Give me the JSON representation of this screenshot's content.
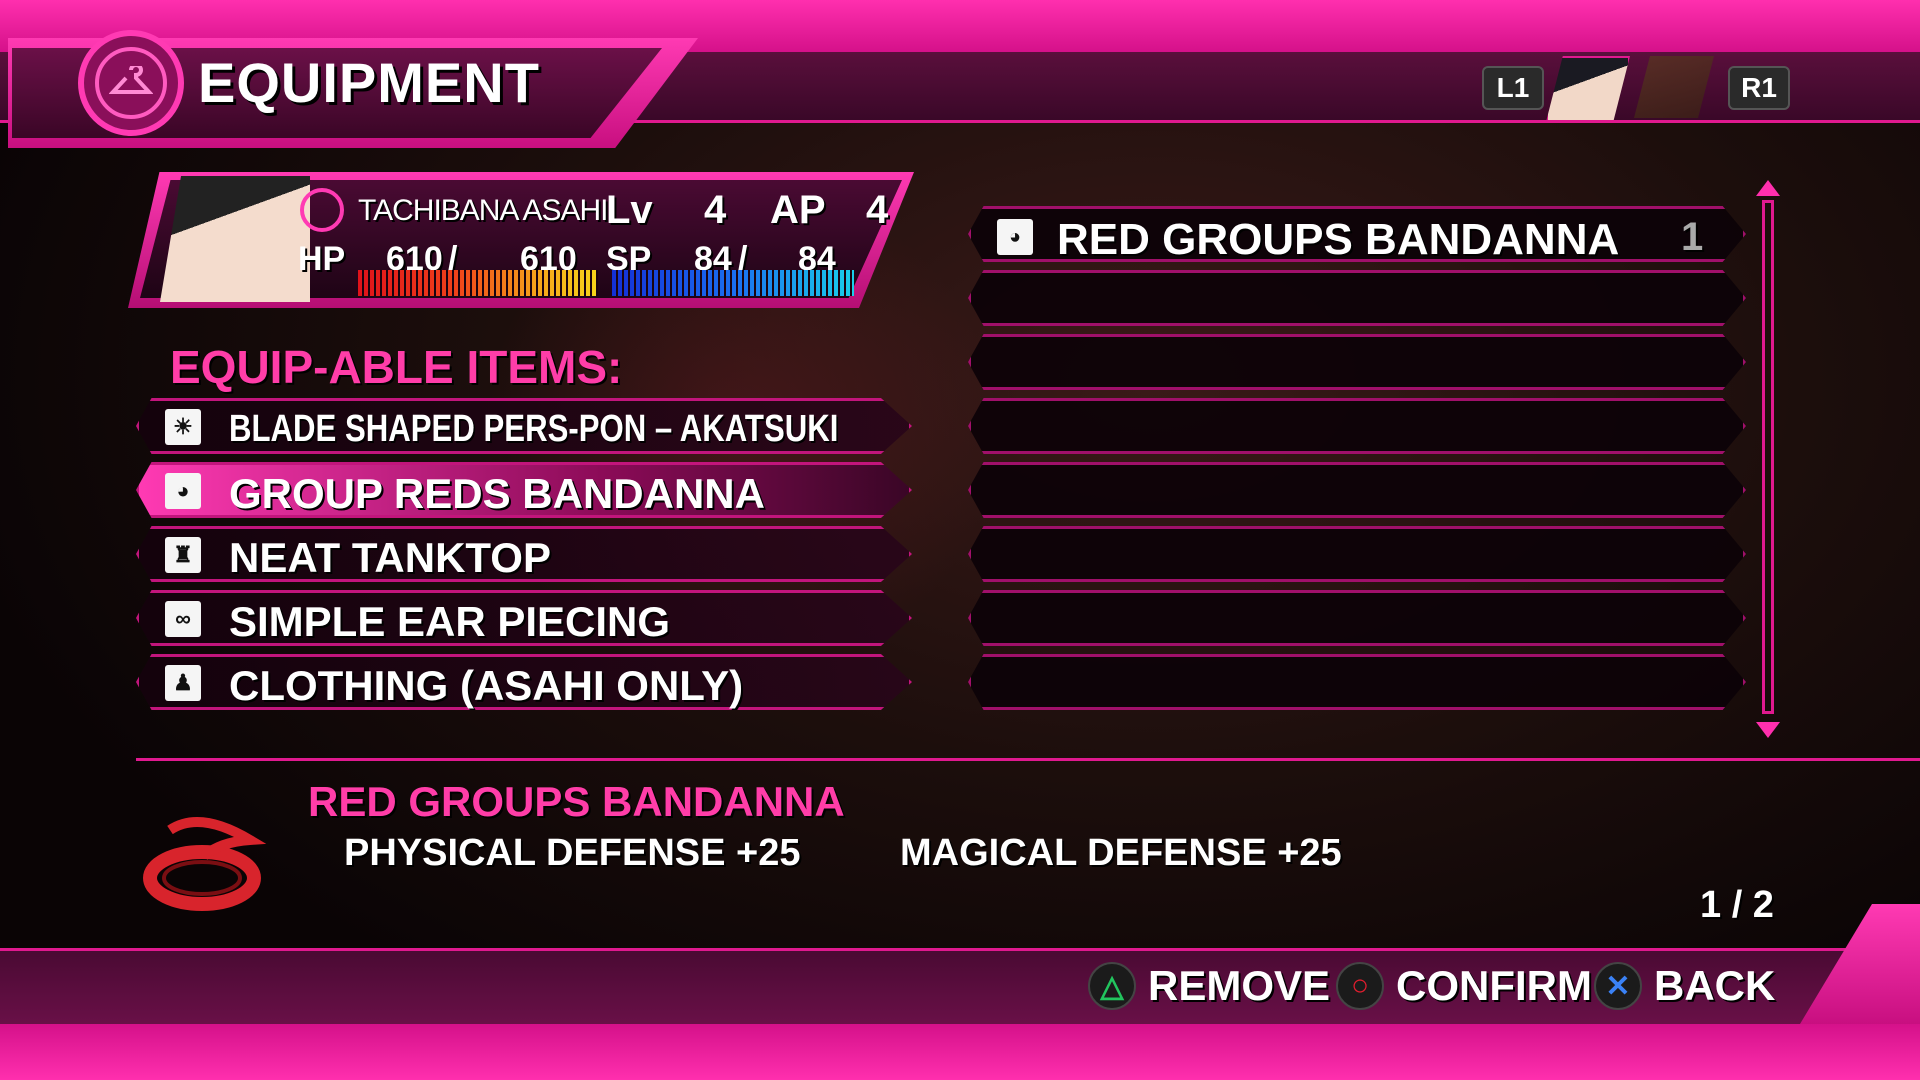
{
  "header": {
    "title": "EQUIPMENT",
    "left_shoulder": "L1",
    "right_shoulder": "R1"
  },
  "character": {
    "name": "TACHIBANA ASAHI",
    "lv_label": "Lv",
    "lv": "4",
    "ap_label": "AP",
    "ap": "4",
    "hp_label": "HP",
    "hp_current": "610",
    "hp_max": "610",
    "sp_label": "SP",
    "sp_current": "84",
    "sp_max": "84",
    "hp_fill": 1.0,
    "sp_fill": 1.0
  },
  "equip": {
    "heading": "EQUIP-ABLE ITEMS:",
    "slots": [
      {
        "label": "BLADE SHAPED PERS-PON – AKATSUKI",
        "icon": "weapon-icon"
      },
      {
        "label": "GROUP REDS BANDANNA",
        "icon": "headgear-icon"
      },
      {
        "label": "NEAT TANKTOP",
        "icon": "body-armor-icon"
      },
      {
        "label": "SIMPLE EAR PIECING",
        "icon": "accessory-icon"
      },
      {
        "label": "CLOTHING (ASAHI ONLY)",
        "icon": "clothing-icon"
      }
    ]
  },
  "inventory": {
    "items": [
      {
        "label": "RED GROUPS BANDANNA",
        "qty": "1",
        "icon": "headgear-icon"
      }
    ]
  },
  "description": {
    "title": "RED GROUPS BANDANNA",
    "stat1": "PHYSICAL DEFENSE +25",
    "stat2": "MAGICAL DEFENSE +25",
    "page": "1 / 2"
  },
  "controls": {
    "remove": "REMOVE",
    "confirm": "CONFIRM",
    "back": "BACK"
  },
  "colors": {
    "accent": "#ff2fae",
    "heading": "#ff3da8",
    "triangle": "#22c55e",
    "circle": "#e11d2e",
    "cross": "#3b82f6"
  }
}
